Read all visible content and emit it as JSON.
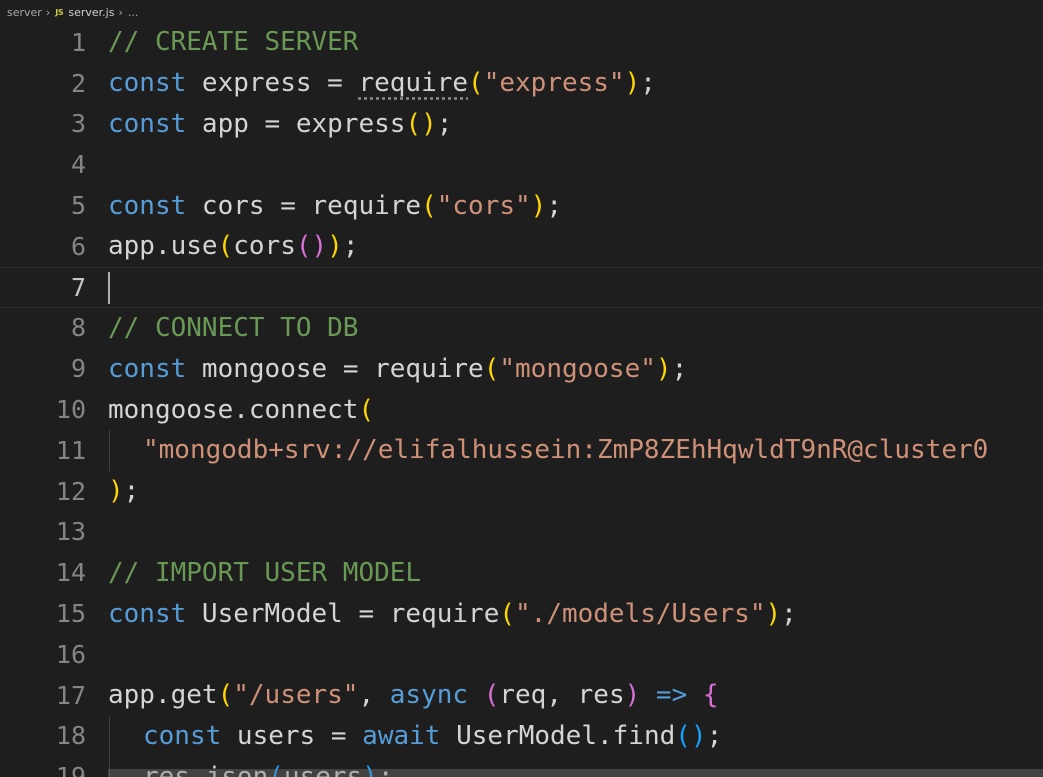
{
  "breadcrumb": {
    "folder": "server",
    "file_badge": "JS",
    "file": "server.js",
    "more": "..."
  },
  "editor": {
    "current_line": 7,
    "lines": [
      {
        "num": "1",
        "tokens": [
          {
            "t": "comment",
            "v": "// CREATE SERVER"
          }
        ]
      },
      {
        "num": "2",
        "tokens": [
          {
            "t": "keyword",
            "v": "const"
          },
          {
            "t": "ident",
            "v": " express = "
          },
          {
            "t": "ident",
            "v": "require",
            "squiggle": true
          },
          {
            "t": "brace1",
            "v": "("
          },
          {
            "t": "string",
            "v": "\"express\""
          },
          {
            "t": "brace1",
            "v": ")"
          },
          {
            "t": "ident",
            "v": ";"
          }
        ]
      },
      {
        "num": "3",
        "tokens": [
          {
            "t": "keyword",
            "v": "const"
          },
          {
            "t": "ident",
            "v": " app = express"
          },
          {
            "t": "brace1",
            "v": "()"
          },
          {
            "t": "ident",
            "v": ";"
          }
        ]
      },
      {
        "num": "4",
        "tokens": []
      },
      {
        "num": "5",
        "tokens": [
          {
            "t": "keyword",
            "v": "const"
          },
          {
            "t": "ident",
            "v": " cors = require"
          },
          {
            "t": "brace1",
            "v": "("
          },
          {
            "t": "string",
            "v": "\"cors\""
          },
          {
            "t": "brace1",
            "v": ")"
          },
          {
            "t": "ident",
            "v": ";"
          }
        ]
      },
      {
        "num": "6",
        "tokens": [
          {
            "t": "ident",
            "v": "app.use"
          },
          {
            "t": "brace1",
            "v": "("
          },
          {
            "t": "ident",
            "v": "cors"
          },
          {
            "t": "brace2",
            "v": "()"
          },
          {
            "t": "brace1",
            "v": ")"
          },
          {
            "t": "ident",
            "v": ";"
          }
        ]
      },
      {
        "num": "7",
        "tokens": [],
        "cursor": true
      },
      {
        "num": "8",
        "tokens": [
          {
            "t": "comment",
            "v": "// CONNECT TO DB"
          }
        ]
      },
      {
        "num": "9",
        "tokens": [
          {
            "t": "keyword",
            "v": "const"
          },
          {
            "t": "ident",
            "v": " mongoose = require"
          },
          {
            "t": "brace1",
            "v": "("
          },
          {
            "t": "string",
            "v": "\"mongoose\""
          },
          {
            "t": "brace1",
            "v": ")"
          },
          {
            "t": "ident",
            "v": ";"
          }
        ]
      },
      {
        "num": "10",
        "tokens": [
          {
            "t": "ident",
            "v": "mongoose.connect"
          },
          {
            "t": "brace1",
            "v": "("
          }
        ]
      },
      {
        "num": "11",
        "indented": true,
        "tokens": [
          {
            "t": "string",
            "v": "\"mongodb+srv://elifalhussein:ZmP8ZEhHqwldT9nR@cluster0"
          }
        ]
      },
      {
        "num": "12",
        "tokens": [
          {
            "t": "brace1",
            "v": ")"
          },
          {
            "t": "ident",
            "v": ";"
          }
        ]
      },
      {
        "num": "13",
        "tokens": []
      },
      {
        "num": "14",
        "tokens": [
          {
            "t": "comment",
            "v": "// IMPORT USER MODEL"
          }
        ]
      },
      {
        "num": "15",
        "tokens": [
          {
            "t": "keyword",
            "v": "const"
          },
          {
            "t": "ident",
            "v": " UserModel = require"
          },
          {
            "t": "brace1",
            "v": "("
          },
          {
            "t": "string",
            "v": "\"./models/Users\""
          },
          {
            "t": "brace1",
            "v": ")"
          },
          {
            "t": "ident",
            "v": ";"
          }
        ]
      },
      {
        "num": "16",
        "tokens": []
      },
      {
        "num": "17",
        "tokens": [
          {
            "t": "ident",
            "v": "app.get"
          },
          {
            "t": "brace1",
            "v": "("
          },
          {
            "t": "string",
            "v": "\"/users\""
          },
          {
            "t": "ident",
            "v": ", "
          },
          {
            "t": "keyword",
            "v": "async"
          },
          {
            "t": "ident",
            "v": " "
          },
          {
            "t": "brace2",
            "v": "("
          },
          {
            "t": "ident",
            "v": "req, res"
          },
          {
            "t": "brace2",
            "v": ")"
          },
          {
            "t": "ident",
            "v": " "
          },
          {
            "t": "keyword",
            "v": "=>"
          },
          {
            "t": "ident",
            "v": " "
          },
          {
            "t": "brace2",
            "v": "{"
          }
        ]
      },
      {
        "num": "18",
        "indented": true,
        "tokens": [
          {
            "t": "keyword",
            "v": "const"
          },
          {
            "t": "ident",
            "v": " users = "
          },
          {
            "t": "keyword",
            "v": "await"
          },
          {
            "t": "ident",
            "v": " UserModel.find"
          },
          {
            "t": "brace3",
            "v": "()"
          },
          {
            "t": "ident",
            "v": ";"
          }
        ]
      },
      {
        "num": "19",
        "indented": true,
        "tokens": [
          {
            "t": "ident",
            "v": "res.json"
          },
          {
            "t": "brace3",
            "v": "("
          },
          {
            "t": "ident",
            "v": "users"
          },
          {
            "t": "brace3",
            "v": ")"
          },
          {
            "t": "ident",
            "v": ";"
          }
        ]
      }
    ]
  }
}
